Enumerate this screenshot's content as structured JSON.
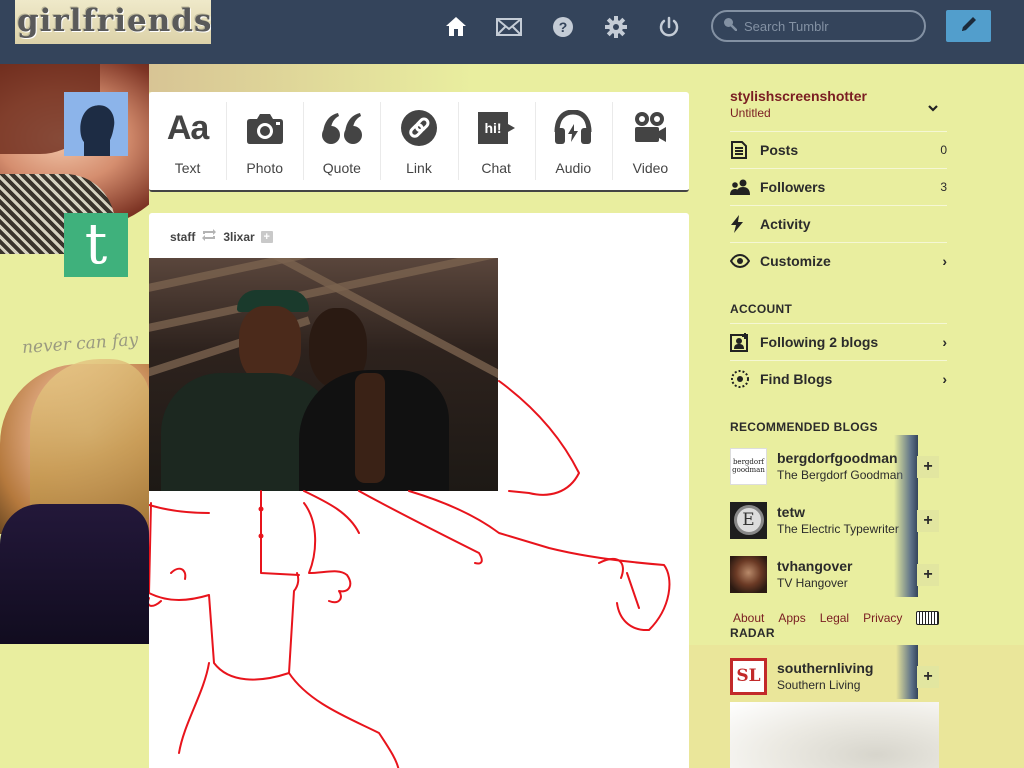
{
  "header": {
    "logo_text": "girlfriends.",
    "nav": [
      {
        "name": "home-icon"
      },
      {
        "name": "mail-icon"
      },
      {
        "name": "help-icon"
      },
      {
        "name": "gear-icon"
      },
      {
        "name": "power-icon"
      }
    ],
    "search_placeholder": "Search Tumblr"
  },
  "post_types": {
    "text": "Text",
    "photo": "Photo",
    "quote": "Quote",
    "link": "Link",
    "chat": "Chat",
    "audio": "Audio",
    "video": "Video",
    "text_glyph": "Aa",
    "quote_glyph": "“",
    "chat_glyph": "hi!"
  },
  "post": {
    "author": "staff",
    "reblogged_from": "3lixar"
  },
  "decor": {
    "script_text": "never can fay",
    "tumblr_glyph": "t"
  },
  "sidebar": {
    "blog_name": "stylishscreenshotter",
    "blog_title": "Untitled",
    "menu": {
      "posts": {
        "label": "Posts",
        "count": "0"
      },
      "followers": {
        "label": "Followers",
        "count": "3"
      },
      "activity": {
        "label": "Activity"
      },
      "customize": {
        "label": "Customize"
      }
    },
    "account_heading": "ACCOUNT",
    "following": "Following 2 blogs",
    "find_blogs": "Find Blogs",
    "recommended_heading": "RECOMMENDED BLOGS",
    "recommended": [
      {
        "name": "bergdorfgoodman",
        "title": "The Bergdorf Goodman",
        "logo": "bergdorf goodman"
      },
      {
        "name": "tetw",
        "title": "The Electric Typewriter",
        "logo": "E"
      },
      {
        "name": "tvhangover",
        "title": "TV Hangover"
      }
    ],
    "footer": {
      "about": "About",
      "apps": "Apps",
      "legal": "Legal",
      "privacy": "Privacy"
    },
    "radar_heading": "RADAR",
    "radar": {
      "name": "southernliving",
      "title": "Southern Living",
      "logo": "SL"
    },
    "add_glyph": "+"
  },
  "colors": {
    "topbar": "#34445b",
    "background": "#e9ee9f",
    "compose": "#529ecc",
    "blog_name": "#7a1d22",
    "doodle": "#e8141c"
  }
}
